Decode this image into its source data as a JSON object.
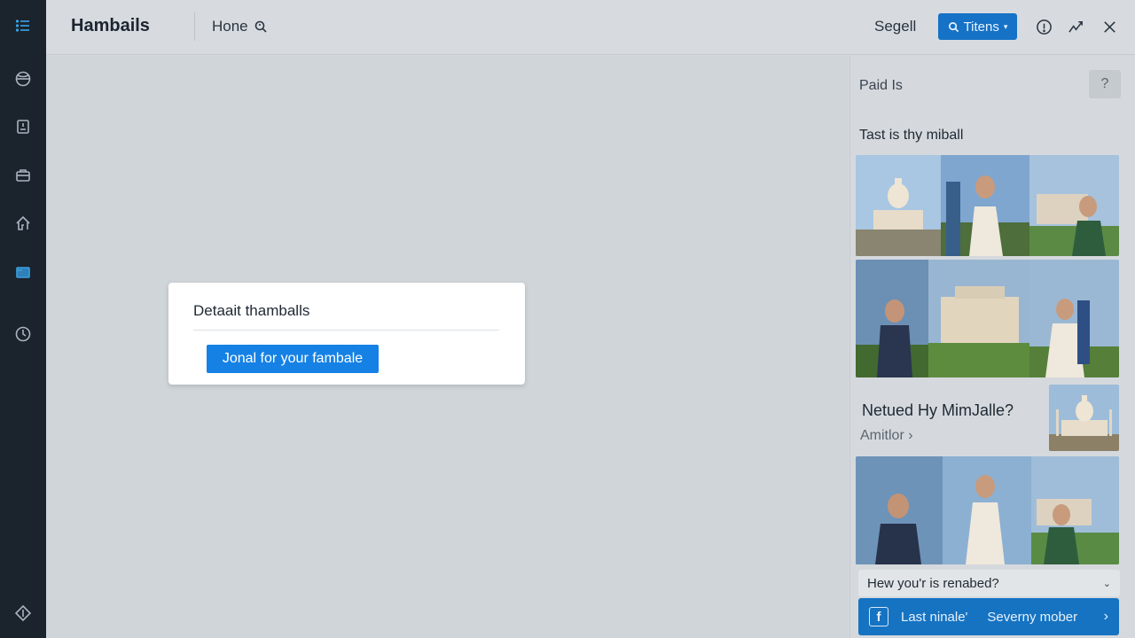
{
  "app": {
    "title": "Hambails"
  },
  "header": {
    "home_label": "Hone",
    "segell_label": "Segell",
    "titens_label": "Titens",
    "icons": [
      "info-icon",
      "activity-icon",
      "close-icon"
    ]
  },
  "sidebar": {
    "icons": [
      "list-icon",
      "globe-icon",
      "clipboard-icon",
      "briefcase-icon",
      "home-icon",
      "monitor-icon",
      "clock-icon",
      "diamond-icon"
    ]
  },
  "dialog": {
    "title": "Detaait thamballs",
    "button_label": "Jonal for your fambale"
  },
  "right_panel": {
    "heading": "Paid Is",
    "help_label": "?",
    "subheading": "Tast is thy miball",
    "featured": {
      "title": "Netued Hy MimJalle?",
      "author": "Amitlor ›"
    },
    "dropdown_label": "Hew you'r is renabed?",
    "promo": {
      "left": "Last ninale'",
      "right": "Severny mober"
    }
  },
  "colors": {
    "rail": "#1b232d",
    "accent": "#1681e4",
    "promo": "#1673c2",
    "topbar": "#d7dbdf",
    "main": "#d0d5d9"
  }
}
